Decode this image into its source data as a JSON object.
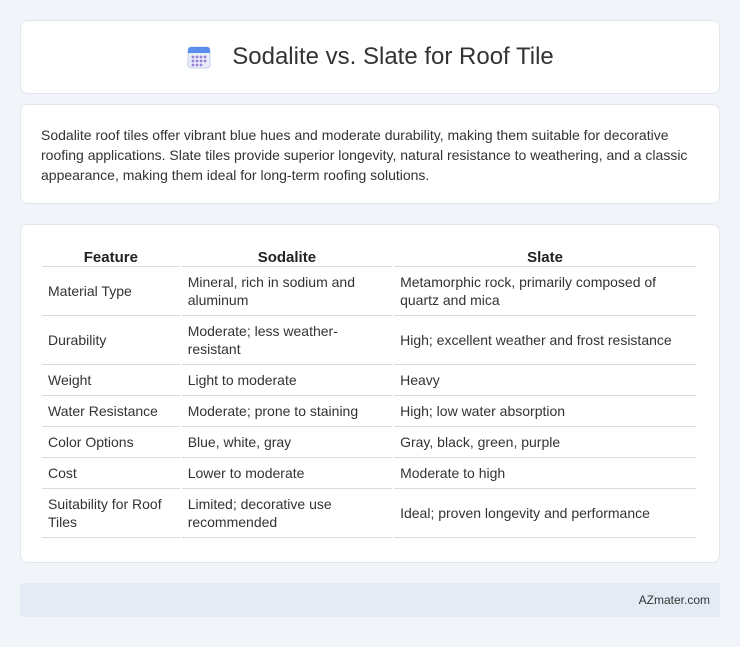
{
  "header": {
    "title": "Sodalite vs. Slate for Roof Tile",
    "icon": "calendar-icon"
  },
  "summary": {
    "text": "Sodalite roof tiles offer vibrant blue hues and moderate durability, making them suitable for decorative roofing applications. Slate tiles provide superior longevity, natural resistance to weathering, and a classic appearance, making them ideal for long-term roofing solutions."
  },
  "table": {
    "headers": [
      "Feature",
      "Sodalite",
      "Slate"
    ],
    "rows": [
      [
        "Material Type",
        "Mineral, rich in sodium and aluminum",
        "Metamorphic rock, primarily composed of quartz and mica"
      ],
      [
        "Durability",
        "Moderate; less weather-resistant",
        "High; excellent weather and frost resistance"
      ],
      [
        "Weight",
        "Light to moderate",
        "Heavy"
      ],
      [
        "Water Resistance",
        "Moderate; prone to staining",
        "High; low water absorption"
      ],
      [
        "Color Options",
        "Blue, white, gray",
        "Gray, black, green, purple"
      ],
      [
        "Cost",
        "Lower to moderate",
        "Moderate to high"
      ],
      [
        "Suitability for Roof Tiles",
        "Limited; decorative use recommended",
        "Ideal; proven longevity and performance"
      ]
    ]
  },
  "footer": {
    "brand": "AZmater.com"
  }
}
